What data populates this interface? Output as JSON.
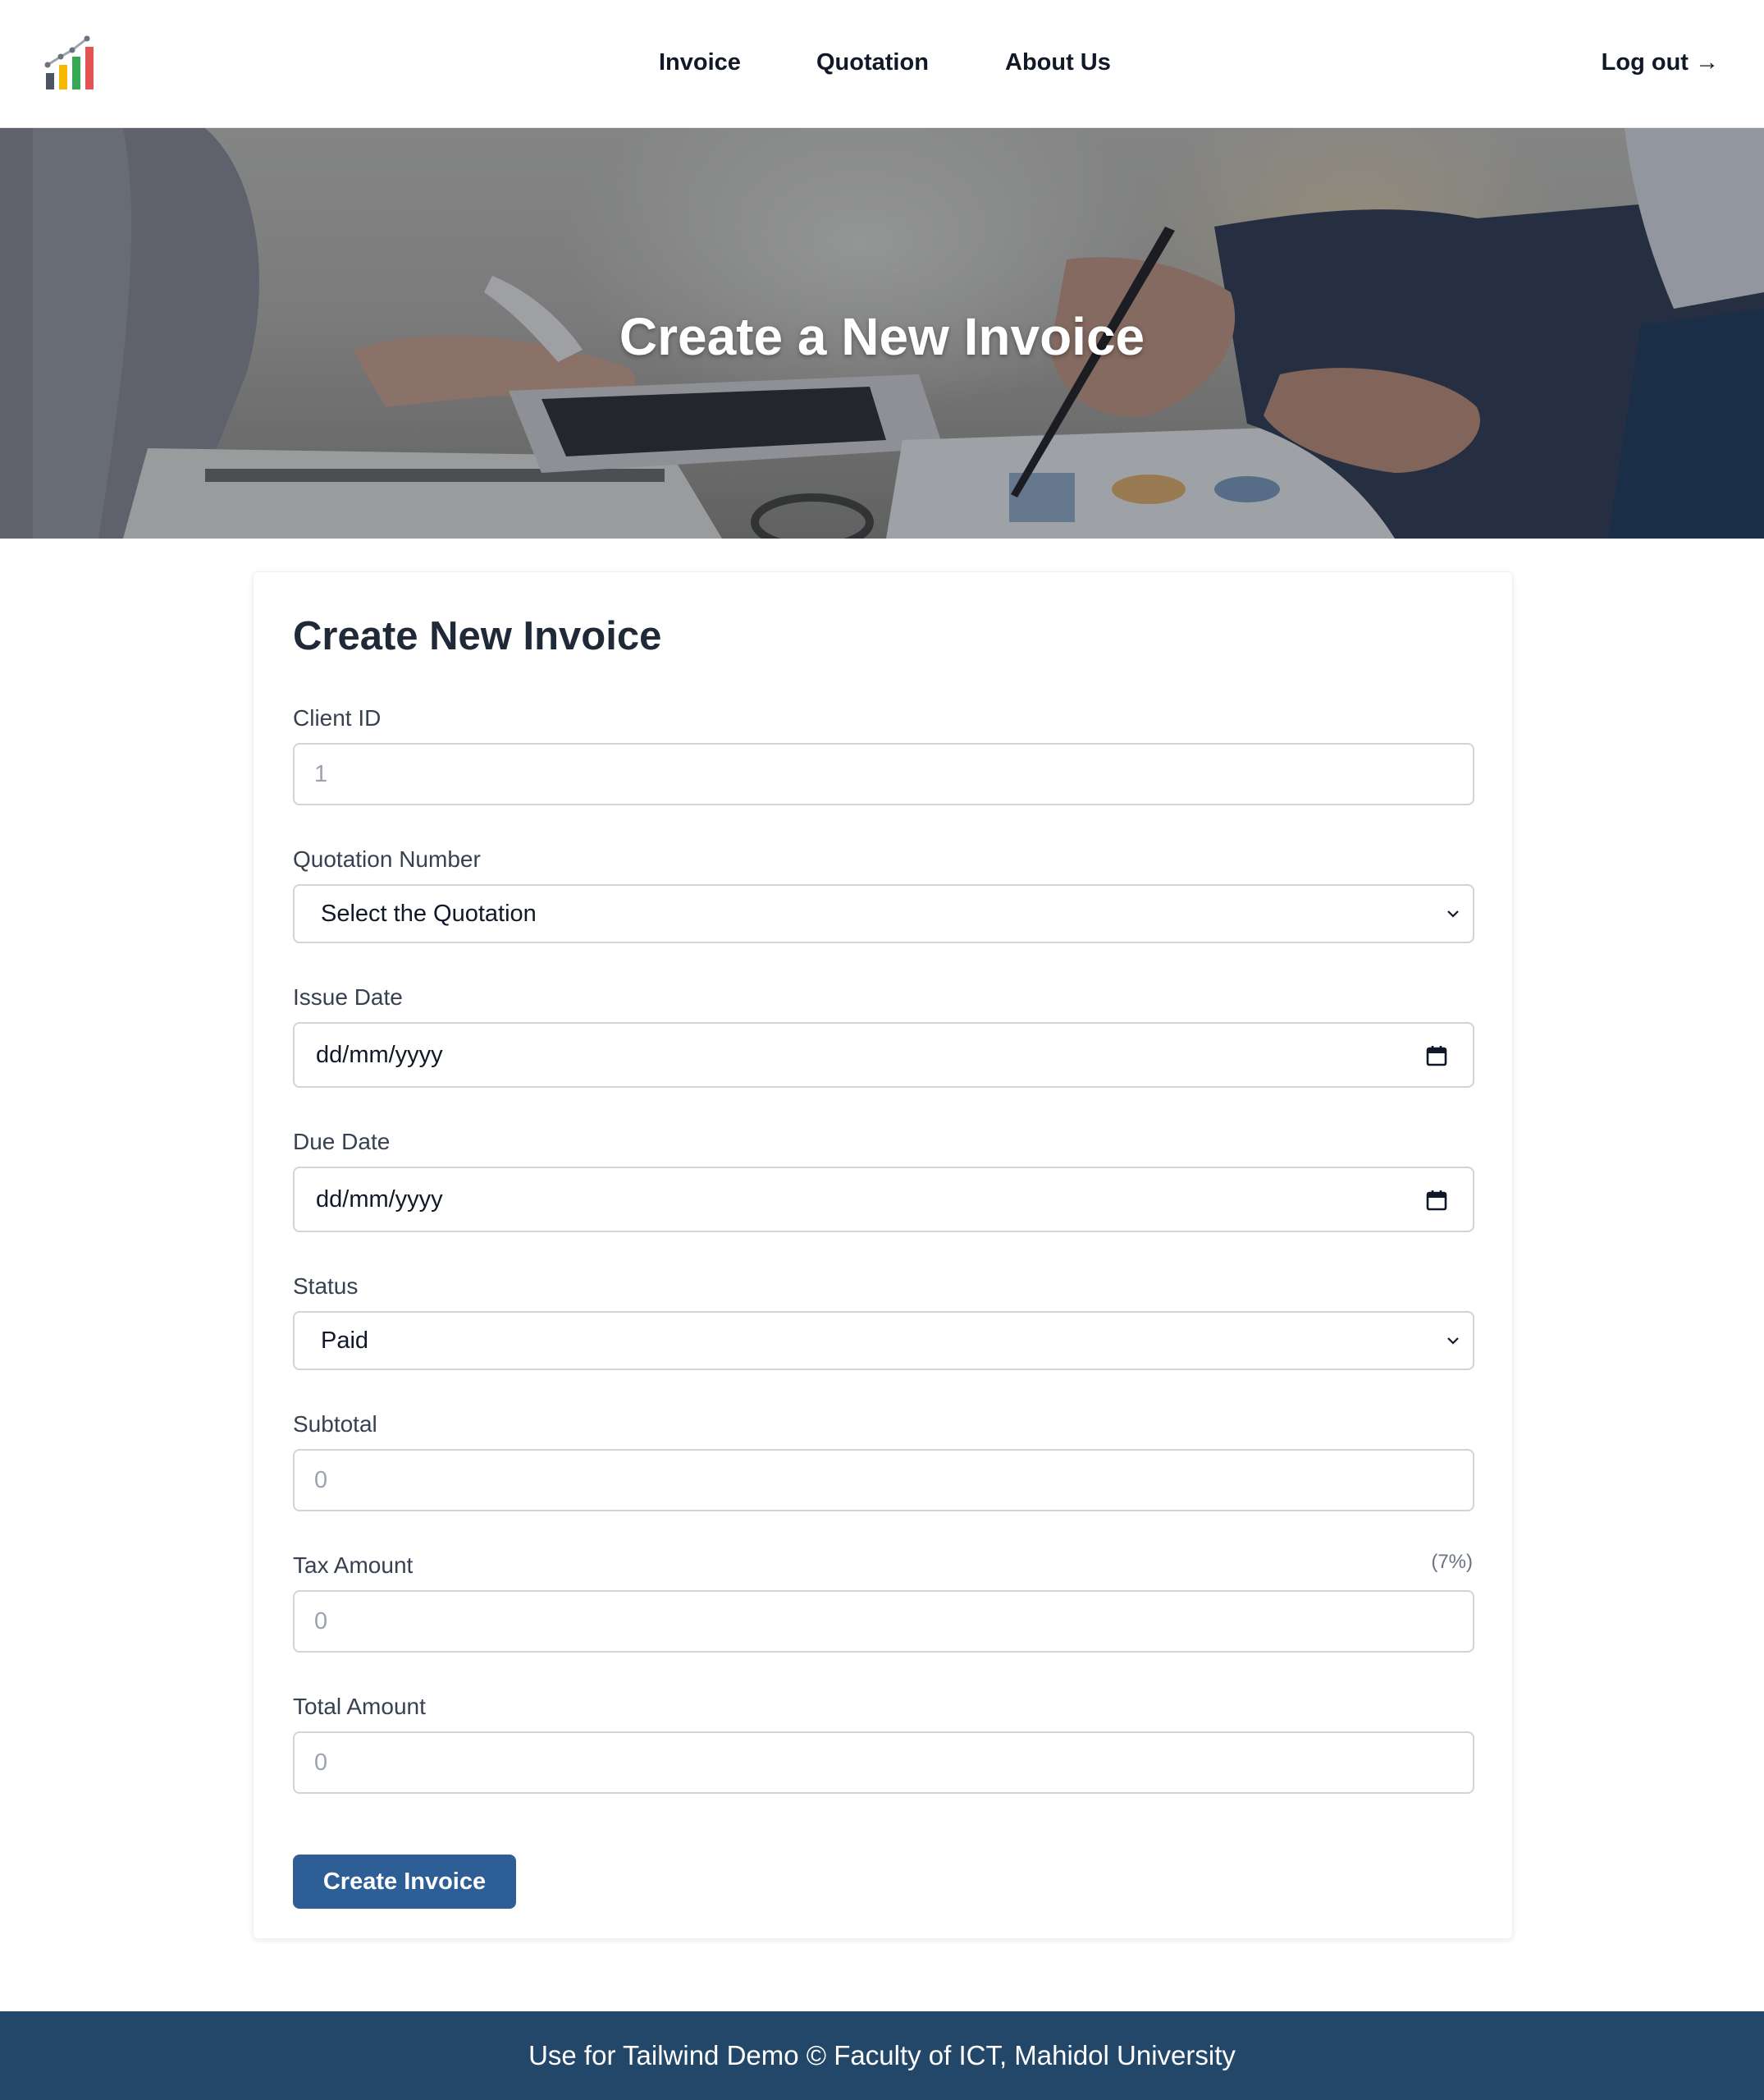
{
  "header": {
    "logo_icon": "bar-chart-growth-icon",
    "nav": [
      {
        "label": "Invoice"
      },
      {
        "label": "Quotation"
      },
      {
        "label": "About Us"
      }
    ],
    "logout_label": "Log out →"
  },
  "hero": {
    "title": "Create a New Invoice"
  },
  "form": {
    "title": "Create New Invoice",
    "client_id": {
      "label": "Client ID",
      "placeholder": "1"
    },
    "quotation_number": {
      "label": "Quotation Number",
      "selected": "Select the Quotation"
    },
    "issue_date": {
      "label": "Issue Date",
      "value": "dd/mm/yyyy"
    },
    "due_date": {
      "label": "Due Date",
      "value": "dd/mm/yyyy"
    },
    "status": {
      "label": "Status",
      "selected": "Paid"
    },
    "subtotal": {
      "label": "Subtotal",
      "placeholder": "0"
    },
    "tax_amount": {
      "label": "Tax Amount",
      "hint": "(7%)",
      "placeholder": "0"
    },
    "total_amount": {
      "label": "Total Amount",
      "placeholder": "0"
    },
    "submit_label": "Create Invoice"
  },
  "footer": {
    "text": "Use for Tailwind Demo © Faculty of ICT, Mahidol University"
  },
  "colors": {
    "primary_button": "#2d5f96",
    "footer_bg": "#234768",
    "input_border": "#d1d5db"
  }
}
